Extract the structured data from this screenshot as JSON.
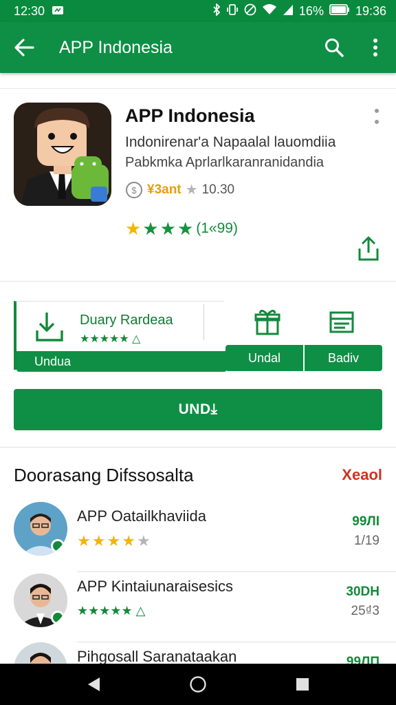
{
  "status_bar": {
    "time_left": "12:30",
    "battery_text": "16%",
    "time_right": "19:36"
  },
  "app_bar": {
    "title": "APP Indonesia"
  },
  "app": {
    "name": "APP Indonesia",
    "developer": "Indonirenar'a Napaalal lauomdiia",
    "category": "Pabkmka Aprlarlkaranranidandia",
    "rating_badge": "¥3ant",
    "downloads": "10.30",
    "rating_count": "(1«99)",
    "rating_stars": 4
  },
  "install_panel": {
    "download_title": "Duary Rardeaa",
    "download_sub": "★★★★★ △",
    "download_bottom_label": "Undua",
    "tab_1": "Undal",
    "tab_2": "Badiv"
  },
  "install_button": {
    "label": "UND⤓"
  },
  "section": {
    "title": "Doorasang Difssosalta",
    "more": "Xeaol"
  },
  "recommendations": [
    {
      "name": "APP Oatailkhaviida",
      "size": "99ЛІ",
      "count": "1/19",
      "stars": 4,
      "star_style": "gold"
    },
    {
      "name": "APP Kintaiunaraisesics",
      "size": "30DH",
      "count": "25₫3",
      "stars_text": "★★★★★ △",
      "star_style": "green"
    },
    {
      "name": "Pihgosall Saranataakan",
      "size": "99ЛП",
      "count": ""
    }
  ],
  "colors": {
    "primary": "#0f8f45",
    "status_bar": "#0a8a3e",
    "accent_red": "#d0311f",
    "star_gold": "#f2b600"
  }
}
